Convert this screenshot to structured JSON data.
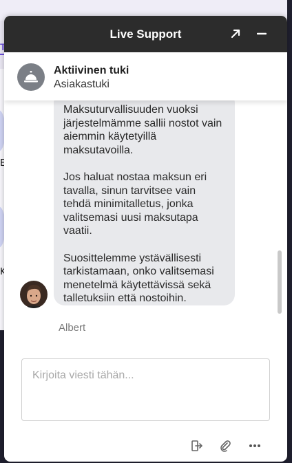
{
  "window": {
    "title": "Live Support",
    "expand_icon": "expand-arrow-icon",
    "minimize_icon": "minimize-icon"
  },
  "agent": {
    "name": "Aktiivinen tuki",
    "role": "Asiakastuki",
    "icon": "service-bell-icon"
  },
  "messages": [
    {
      "paragraphs": [
        "Maksuturvallisuuden vuoksi järjestelmämme sallii nostot vain aiemmin käytetyillä maksutavoilla.",
        "Jos haluat nostaa maksun eri tavalla, sinun tarvitsee vain tehdä minimitalletus, jonka valitsemasi uusi maksutapa vaatii.",
        "Suosittelemme ystävällisesti tarkistamaan, onko valitsemasi menetelmä käytettävissä sekä talletuksiin että nostoihin."
      ],
      "sender": "Albert"
    }
  ],
  "composer": {
    "placeholder": "Kirjoita viesti tähän..."
  },
  "toolbar": {
    "icons": [
      "exit-transfer-icon",
      "paperclip-icon",
      "more-dots-icon"
    ]
  },
  "background": {
    "letters": [
      "T",
      "E",
      "K"
    ]
  }
}
